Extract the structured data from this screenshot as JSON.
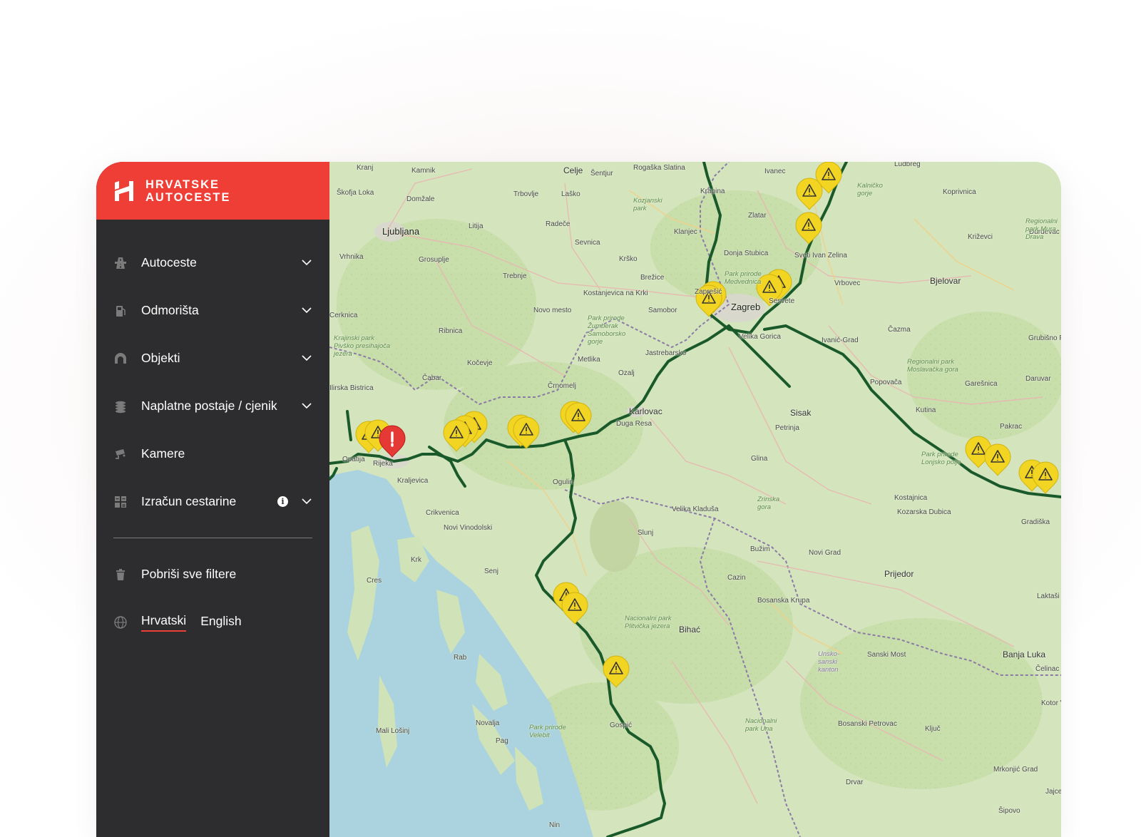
{
  "brand": {
    "line1": "HRVATSKE",
    "line2": "AUTOCESTE",
    "color": "#ef3e36"
  },
  "sidebar": {
    "background": "#2d2d2f",
    "items": [
      {
        "label": "Autoceste",
        "icon": "highway-icon",
        "expandable": true
      },
      {
        "label": "Odmorišta",
        "icon": "fuel-icon",
        "expandable": true
      },
      {
        "label": "Objekti",
        "icon": "tunnel-icon",
        "expandable": true
      },
      {
        "label": "Naplatne postaje / cjenik",
        "icon": "coins-icon",
        "expandable": true
      },
      {
        "label": "Kamere",
        "icon": "camera-icon",
        "expandable": false
      },
      {
        "label": "Izračun cestarine",
        "icon": "calculator-icon",
        "expandable": true,
        "info": "i"
      }
    ],
    "clear_filters": {
      "label": "Pobriši sve filtere",
      "icon": "trash-icon"
    },
    "languages": {
      "icon": "globe-icon",
      "options": [
        "Hrvatski",
        "English"
      ],
      "active": "Hrvatski"
    }
  },
  "map": {
    "route_color": "#1a5a2a",
    "warning_color": "#f2d422",
    "alert_color": "#e53935",
    "places": [
      "Kranj",
      "Kamnik",
      "Celje",
      "Šentjur",
      "Rogaška Slatina",
      "Krapina",
      "Ivanec",
      "Ludbreg",
      "Škofja Loka",
      "Domžale",
      "Trbovlje",
      "Laško",
      "Ljubljana",
      "Litija",
      "Radeče",
      "Sevnica",
      "Zlatar",
      "Koprivnica",
      "Vrhnika",
      "Grosuplje",
      "Krško",
      "Brežice",
      "Klanjec",
      "Donja Stubica",
      "Križevci",
      "Đurđevac",
      "Trebnje",
      "Kostanjevica na Krki",
      "Novo mesto",
      "Samobor",
      "Zaprešić",
      "Zagreb",
      "Sesvete",
      "Sveti Ivan Zelina",
      "Vrbovec",
      "Bjelovar",
      "Cerknica",
      "Ribnica",
      "Velika Gorica",
      "Ivanić-Grad",
      "Čazma",
      "Grubišno Polje",
      "Kočevje",
      "Metlika",
      "Jastrebarsko",
      "Ozalj",
      "Čabar",
      "Črnomelj",
      "Kutina",
      "Garešnica",
      "Daruvar",
      "Ilirska Bistrica",
      "Karlovac",
      "Duga Resa",
      "Sisak",
      "Petrinja",
      "Pakrac",
      "Popovača",
      "Opatija",
      "Rijeka",
      "Kraljevica",
      "Ogulin",
      "Glina",
      "Crikvenica",
      "Novi Vinodolski",
      "Velika Kladuša",
      "Kostajnica",
      "Kozarska Dubica",
      "Gradiška",
      "Krk",
      "Slunj",
      "Novi Grad",
      "Bužim",
      "Prijedor",
      "Senj",
      "Cres",
      "Cazin",
      "Bosanska Krupa",
      "Bihać",
      "Laktaši",
      "Rab",
      "Sanski Most",
      "Banja Luka",
      "Čelinac",
      "Novalja",
      "Gospić",
      "Bosanski Petrovac",
      "Ključ",
      "Kotor Varoš",
      "Mali Lošinj",
      "Pag",
      "Mrkonjić Grad",
      "Drvar",
      "Jajce",
      "Šipovo",
      "Nin"
    ],
    "parks": [
      "Kozjanski park",
      "Park prirode Medvednica",
      "Park prirode Žumberak Samoborsko gorje",
      "Krajinski park Pivško presihajoča jezera",
      "Regionalni park Moslavačka gora",
      "Park prirode Lonjsko polje",
      "Regionalni park Mura Drava",
      "Kalničko gorje",
      "Nacionalni park Plitvička jezera",
      "Zrinska gora",
      "Park prirode Velebit",
      "Nacionalni park Una",
      "Unsko-sanski kanton"
    ]
  }
}
